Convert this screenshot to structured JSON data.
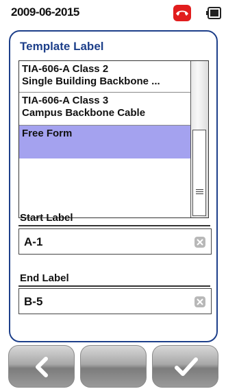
{
  "status": {
    "datetime": "2009-06-2015",
    "icons": [
      "phone-hangup-icon",
      "battery-icon"
    ],
    "phone_color": "#e11d1d"
  },
  "panel": {
    "title": "Template Label",
    "template_list": {
      "items": [
        {
          "line1": "TIA-606-A Class 2",
          "line2": "Single Building Backbone ..."
        },
        {
          "line1": "TIA-606-A Class 3",
          "line2": "Campus Backbone Cable"
        },
        {
          "line1": "Free Form",
          "line2": ""
        }
      ],
      "selected": "Free Form",
      "selection_color": "#a4a2ef"
    },
    "start_label": {
      "label": "Start Label",
      "value": "A-1"
    },
    "end_label": {
      "label": "End Label",
      "value": "B-5"
    }
  },
  "buttons": {
    "back_icon": "chevron-left-icon",
    "confirm_icon": "checkmark-icon"
  },
  "colors": {
    "accent": "#1d3f8a"
  }
}
